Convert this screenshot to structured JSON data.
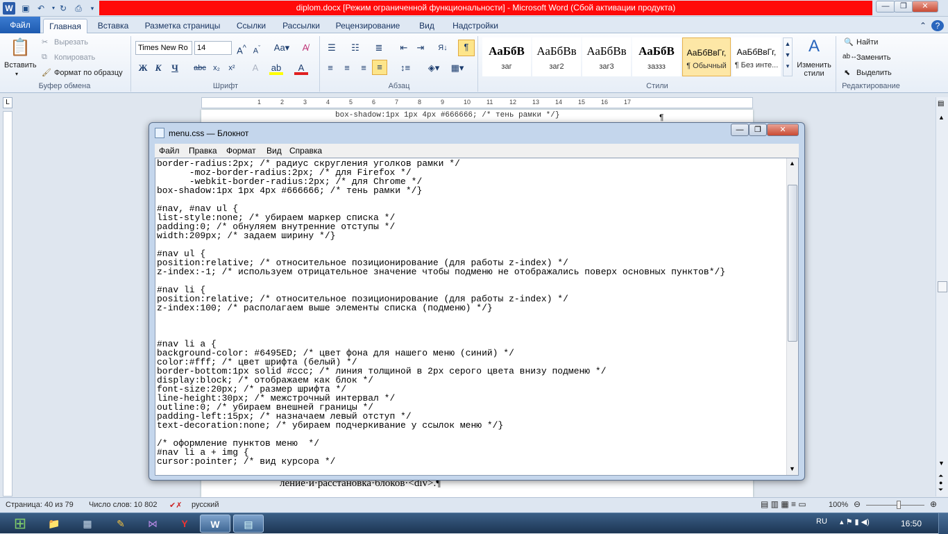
{
  "word": {
    "title": "diplom.docx [Режим ограниченной функциональности]  -  Microsoft Word (Сбой активации продукта)",
    "tabs": [
      "Файл",
      "Главная",
      "Вставка",
      "Разметка страницы",
      "Ссылки",
      "Рассылки",
      "Рецензирование",
      "Вид",
      "Надстройки"
    ],
    "clipboard": {
      "paste": "Вставить",
      "cut": "Вырезать",
      "copy": "Копировать",
      "format_painter": "Формат по образцу",
      "group": "Буфер обмена"
    },
    "font": {
      "name": "Times New Ro",
      "size": "14",
      "group": "Шрифт"
    },
    "paragraph_group": "Абзац",
    "styles": {
      "items": [
        {
          "preview": "АаБбВ",
          "name": "заг"
        },
        {
          "preview": "АаБбВв",
          "name": "заг2"
        },
        {
          "preview": "АаБбВв",
          "name": "заг3"
        },
        {
          "preview": "АаБбВ",
          "name": "заззз"
        },
        {
          "preview": "АаБбВвГг,",
          "name": "¶ Обычный"
        },
        {
          "preview": "АаБбВвГг,",
          "name": "¶ Без инте..."
        }
      ],
      "change": "Изменить стили",
      "group": "Стили"
    },
    "editing": {
      "find": "Найти",
      "replace": "Заменить",
      "select": "Выделить",
      "group": "Редактирование"
    },
    "ruler_marks": [
      "1",
      "2",
      "3",
      "4",
      "5",
      "6",
      "7",
      "8",
      "9",
      "10",
      "11",
      "12",
      "13",
      "14",
      "15",
      "16",
      "17"
    ],
    "doc_top_line": "box-shadow:1px 1px 4px #666666; /* тень рамки */}",
    "doc_bottom_line": "ление·и·расстановка·блоков·<div>.¶",
    "status": {
      "page": "Страница: 40 из 79",
      "words": "Число слов: 10 802",
      "lang": "русский",
      "zoom": "100%"
    }
  },
  "notepad": {
    "title": "menu.css — Блокнот",
    "menu": [
      "Файл",
      "Правка",
      "Формат",
      "Вид",
      "Справка"
    ],
    "lines": [
      "border-radius:2px; /* радиус скругления уголков рамки */",
      "      -moz-border-radius:2px; /* для Firefox */",
      "      -webkit-border-radius:2px; /* для Chrome */",
      "box-shadow:1px 1px 4px #666666; /* тень рамки */}",
      "",
      "#nav, #nav ul {",
      "list-style:none; /* убираем маркер списка */",
      "padding:0; /* обнуляем внутренние отступы */",
      "width:209px; /* задаем ширину */}",
      "",
      "#nav ul {",
      "position:relative; /* относительное позиционирование (для работы z-index) */",
      "z-index:-1; /* используем отрицательное значение чтобы подменю не отображались поверх основных пунктов*/}",
      "",
      "#nav li {",
      "position:relative; /* относительное позиционирование (для работы z-index) */",
      "z-index:100; /* располагаем выше элементы списка (подменю) */}",
      "",
      "",
      "",
      "#nav li a {",
      "background-color: #6495ED; /* цвет фона для нашего меню (синий) */",
      "color:#fff; /* цвет шрифта (белый) */",
      "border-bottom:1px solid #ccc; /* линия толщиной в 2px серого цвета внизу подменю */",
      "display:block; /* отображаем как блок */",
      "font-size:20px; /* размер шрифта */",
      "line-height:30px; /* межстрочный интервал */",
      "outline:0; /* убираем внешней границы */",
      "padding-left:15px; /* назначаем левый отступ */",
      "text-decoration:none; /* убираем подчеркивание у ссылок меню */}",
      "",
      "/* оформление пунктов меню  */",
      "#nav li a + img {",
      "cursor:pointer; /* вид курсора */"
    ]
  },
  "taskbar": {
    "lang": "RU",
    "time": "16:50"
  },
  "colors": {
    "title_red": "#ff0a0a",
    "file_tab": "#2a66bd",
    "taskbar": "#2a4a70"
  }
}
